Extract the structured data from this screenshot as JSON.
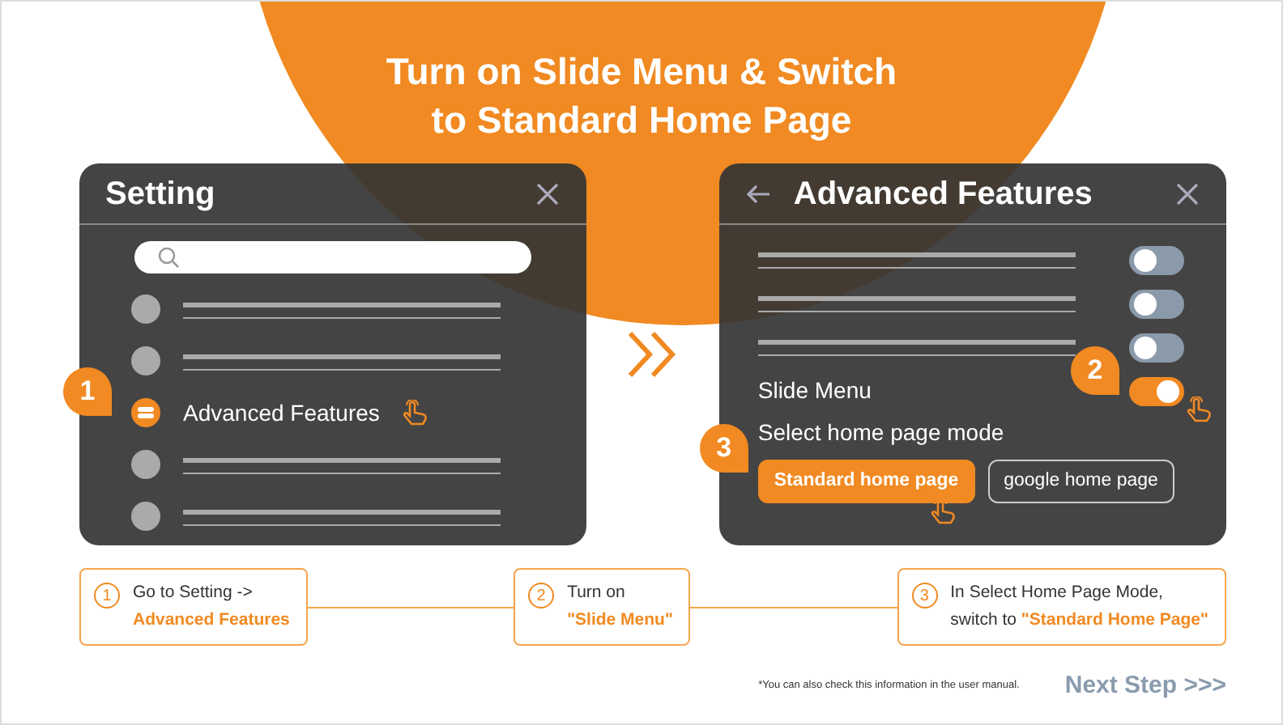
{
  "title_lines": [
    "Turn on Slide Menu & Switch",
    "to Standard Home Page"
  ],
  "setting_panel": {
    "title": "Setting",
    "items": [
      {
        "kind": "placeholder",
        "selected": false
      },
      {
        "kind": "placeholder",
        "selected": false
      },
      {
        "kind": "item",
        "label": "Advanced Features",
        "selected": true,
        "step": "1"
      },
      {
        "kind": "placeholder",
        "selected": false
      },
      {
        "kind": "placeholder",
        "selected": false
      }
    ]
  },
  "advanced_panel": {
    "title": "Advanced Features",
    "toggles": [
      {
        "kind": "placeholder",
        "on": false
      },
      {
        "kind": "placeholder",
        "on": false
      },
      {
        "kind": "placeholder",
        "on": false
      },
      {
        "kind": "labeled",
        "label": "Slide Menu",
        "on": true,
        "step": "2"
      }
    ],
    "mode_label": "Select home page mode",
    "mode_step": "3",
    "modes": [
      {
        "label": "Standard home page",
        "selected": true
      },
      {
        "label": "google home page",
        "selected": false
      }
    ]
  },
  "steps": [
    {
      "number": "1",
      "lines": [
        [
          {
            "text": "Go to Setting ->",
            "highlight": false
          }
        ],
        [
          {
            "text": "Advanced Features",
            "highlight": true
          }
        ]
      ]
    },
    {
      "number": "2",
      "lines": [
        [
          {
            "text": "Turn on",
            "highlight": false
          }
        ],
        [
          {
            "text": "\"Slide Menu\"",
            "highlight": true
          }
        ]
      ]
    },
    {
      "number": "3",
      "lines": [
        [
          {
            "text": "In Select Home Page Mode,",
            "highlight": false
          }
        ],
        [
          {
            "text": "switch to",
            "highlight": false
          },
          {
            "text": "\"Standard Home Page\"",
            "highlight": true
          }
        ]
      ]
    }
  ],
  "footnote": "*You can also check this information in the user manual.",
  "next_step": "Next Step >>>"
}
